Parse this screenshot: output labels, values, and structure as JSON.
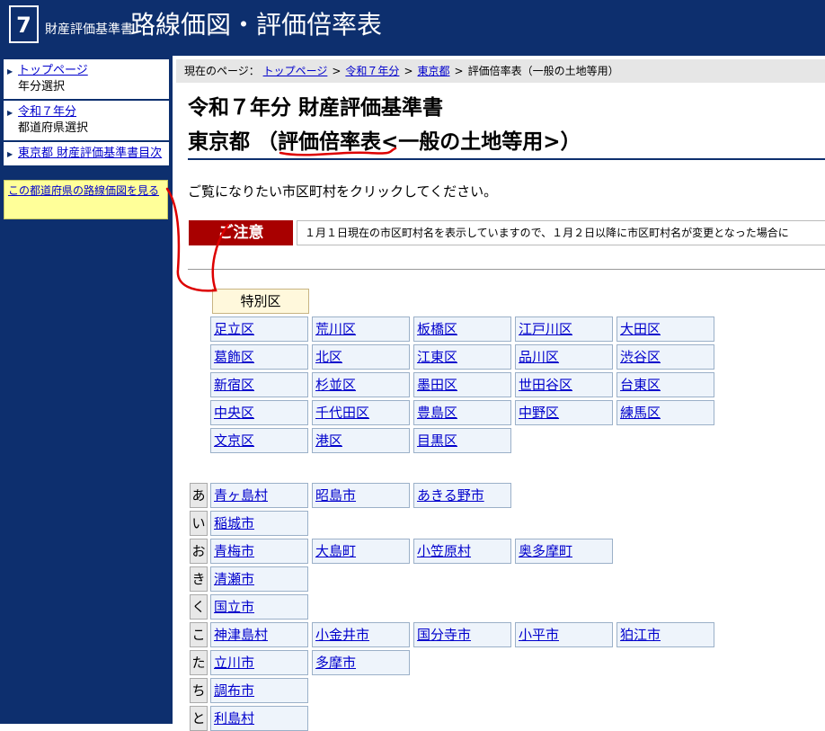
{
  "header": {
    "logo_number": "7",
    "subtitle": "財産評価基準書",
    "title": "路線価図・評価倍率表"
  },
  "sidebar": {
    "items": [
      {
        "link": "トップページ",
        "note": "年分選択"
      },
      {
        "link": "令和７年分",
        "note": "都道府県選択"
      },
      {
        "link": "東京都  財産評価基準書目次",
        "note": ""
      }
    ],
    "yellow_link": "この都道府県の路線価図を見る"
  },
  "breadcrumb": {
    "prefix": "現在のページ：",
    "links": [
      "トップページ",
      "令和７年分",
      "東京都"
    ],
    "sep": ">",
    "current": "評価倍率表（一般の土地等用）"
  },
  "main": {
    "title_line1": "令和７年分  財産評価基準書",
    "title_line2": "東京都  （評価倍率表<一般の土地等用>）",
    "instruction": "ご覧になりたい市区町村をクリックしてください。",
    "caution_label": "ご注意",
    "caution_text": "１月１日現在の市区町村名を表示していますので、１月２日以降に市区町村名が変更となった場合に"
  },
  "wards": {
    "header": "特別区",
    "rows": [
      [
        "足立区",
        "荒川区",
        "板橋区",
        "江戸川区",
        "大田区"
      ],
      [
        "葛飾区",
        "北区",
        "江東区",
        "品川区",
        "渋谷区"
      ],
      [
        "新宿区",
        "杉並区",
        "墨田区",
        "世田谷区",
        "台東区"
      ],
      [
        "中央区",
        "千代田区",
        "豊島区",
        "中野区",
        "練馬区"
      ],
      [
        "文京区",
        "港区",
        "目黒区"
      ]
    ]
  },
  "municipalities": [
    {
      "kana": "あ",
      "items": [
        "青ヶ島村",
        "昭島市",
        "あきる野市"
      ]
    },
    {
      "kana": "い",
      "items": [
        "稲城市"
      ]
    },
    {
      "kana": "お",
      "items": [
        "青梅市",
        "大島町",
        "小笠原村",
        "奥多摩町"
      ]
    },
    {
      "kana": "き",
      "items": [
        "清瀬市"
      ]
    },
    {
      "kana": "く",
      "items": [
        "国立市"
      ]
    },
    {
      "kana": "こ",
      "items": [
        "神津島村",
        "小金井市",
        "国分寺市",
        "小平市",
        "狛江市"
      ]
    },
    {
      "kana": "た",
      "items": [
        "立川市",
        "多摩市"
      ]
    },
    {
      "kana": "ち",
      "items": [
        "調布市"
      ]
    },
    {
      "kana": "と",
      "items": [
        "利島村"
      ]
    }
  ],
  "colors": {
    "navy": "#0d2f6e",
    "caution_red": "#a80000",
    "annotation_red": "#dd0000",
    "link": "#0000cc"
  }
}
